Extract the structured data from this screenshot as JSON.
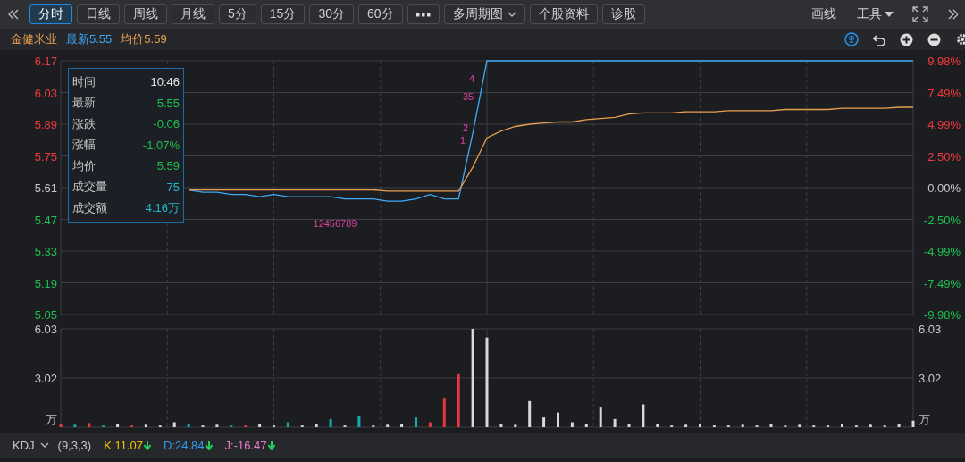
{
  "toolbar": {
    "tabs": [
      {
        "kind": "text",
        "label": "分时",
        "selected": true
      },
      {
        "kind": "text",
        "label": "日线",
        "selected": false
      },
      {
        "kind": "text",
        "label": "周线",
        "selected": false
      },
      {
        "kind": "text",
        "label": "月线",
        "selected": false
      },
      {
        "kind": "text",
        "label": "5分",
        "selected": false
      },
      {
        "kind": "text",
        "label": "15分",
        "selected": false
      },
      {
        "kind": "text",
        "label": "30分",
        "selected": false
      },
      {
        "kind": "text",
        "label": "60分",
        "selected": false
      },
      {
        "kind": "more",
        "selected": false
      },
      {
        "kind": "dropdown",
        "label": "多周期图",
        "selected": false
      },
      {
        "kind": "text",
        "label": "个股资料",
        "selected": false
      },
      {
        "kind": "text",
        "label": "诊股",
        "selected": false
      }
    ],
    "tools": [
      {
        "kind": "plain",
        "label": "画线"
      },
      {
        "kind": "dropdown",
        "label": "工具"
      }
    ]
  },
  "quote": {
    "name": "金健米业",
    "latest": "最新5.55",
    "average": "均价5.59"
  },
  "price_panel": {
    "chart_data": {
      "type": "line",
      "grid": true,
      "ylim": [
        5.05,
        6.17
      ],
      "yticks": [
        6.17,
        6.03,
        5.89,
        5.75,
        5.61,
        5.47,
        5.33,
        5.19,
        5.05
      ],
      "series": [
        {
          "color": "#3fa9f5",
          "values": [
            5.6,
            5.59,
            5.59,
            5.58,
            5.58,
            5.57,
            5.58,
            5.57,
            5.57,
            5.57,
            5.57,
            5.56,
            5.56,
            5.56,
            5.55,
            5.55,
            5.56,
            5.58,
            5.56,
            5.56,
            5.85,
            6.17,
            6.17,
            6.17,
            6.17,
            6.17,
            6.17,
            6.17,
            6.17,
            6.17,
            6.17,
            6.17,
            6.17,
            6.17,
            6.17,
            6.17,
            6.17,
            6.17,
            6.17,
            6.17,
            6.17,
            6.17,
            6.17,
            6.17,
            6.17,
            6.17,
            6.17,
            6.17,
            6.17,
            6.17,
            6.17,
            6.17
          ]
        },
        {
          "color": "#e8a050",
          "values": [
            5.6,
            5.6,
            5.6,
            5.6,
            5.6,
            5.6,
            5.6,
            5.6,
            5.6,
            5.6,
            5.6,
            5.6,
            5.6,
            5.6,
            5.595,
            5.595,
            5.595,
            5.595,
            5.595,
            5.595,
            5.7,
            5.83,
            5.86,
            5.88,
            5.89,
            5.895,
            5.9,
            5.9,
            5.91,
            5.915,
            5.92,
            5.935,
            5.94,
            5.94,
            5.94,
            5.945,
            5.945,
            5.945,
            5.95,
            5.95,
            5.95,
            5.95,
            5.955,
            5.955,
            5.955,
            5.955,
            5.96,
            5.96,
            5.96,
            5.96,
            5.965,
            5.965
          ]
        }
      ],
      "annotations": [
        "12456789",
        "1",
        "2",
        "35",
        "4"
      ]
    },
    "pct_ticks": [
      {
        "label": "9.98%",
        "kind": "up"
      },
      {
        "label": "7.49%",
        "kind": "up"
      },
      {
        "label": "4.99%",
        "kind": "up"
      },
      {
        "label": "2.50%",
        "kind": "up"
      },
      {
        "label": "0.00%",
        "kind": "flat"
      },
      {
        "label": "-2.50%",
        "kind": "down"
      },
      {
        "label": "-4.99%",
        "kind": "down"
      },
      {
        "label": "-7.49%",
        "kind": "down"
      },
      {
        "label": "-9.98%",
        "kind": "down"
      }
    ],
    "tooltip": [
      {
        "label": "时间",
        "value": "10:46",
        "color": "#e6e6e6"
      },
      {
        "label": "最新",
        "value": "5.55",
        "color": "#1fbf4f"
      },
      {
        "label": "涨跌",
        "value": "-0.06",
        "color": "#1fbf4f"
      },
      {
        "label": "涨幅",
        "value": "-1.07%",
        "color": "#1fbf4f"
      },
      {
        "label": "均价",
        "value": "5.59",
        "color": "#1fbf4f"
      },
      {
        "label": "成交量",
        "value": "75",
        "color": "#22b8c8"
      },
      {
        "label": "成交额",
        "value": "4.16万",
        "color": "#22b8c8"
      }
    ]
  },
  "volume_panel": {
    "chart_data": {
      "type": "bar",
      "stacked": true,
      "grid": true,
      "ylim": [
        0,
        6.03
      ],
      "yticks": [
        3.02,
        6.03
      ],
      "ylabel": "万",
      "series": [
        {
          "color": "#e8383d",
          "values": [
            0.2,
            null,
            0.25,
            null,
            null,
            0.1,
            null,
            null,
            null,
            null,
            null,
            null,
            null,
            0.1,
            null,
            null,
            null,
            null,
            null,
            null,
            null,
            null,
            null,
            null,
            null,
            null,
            0.3,
            1.8,
            3.3,
            null,
            null,
            null,
            null,
            null,
            null,
            null,
            null,
            null,
            null,
            null,
            null,
            null,
            null,
            null,
            null,
            null,
            null,
            null,
            null,
            null,
            null,
            null,
            null,
            null,
            null,
            null,
            null,
            null,
            null,
            null,
            null
          ]
        },
        {
          "color": "#1aa9a9",
          "values": [
            null,
            0.15,
            null,
            0.1,
            null,
            null,
            null,
            null,
            null,
            0.2,
            null,
            null,
            0.1,
            null,
            null,
            null,
            0.3,
            null,
            null,
            0.5,
            null,
            0.7,
            null,
            null,
            null,
            0.6,
            null,
            null,
            null,
            null,
            null,
            null,
            null,
            null,
            null,
            null,
            null,
            null,
            null,
            null,
            null,
            null,
            null,
            null,
            null,
            null,
            null,
            null,
            null,
            null,
            null,
            null,
            null,
            null,
            null,
            null,
            null,
            null,
            null,
            null,
            null
          ]
        },
        {
          "color": "#d8d8d8",
          "values": [
            null,
            null,
            null,
            null,
            0.2,
            null,
            0.15,
            0.1,
            0.3,
            null,
            0.1,
            0.15,
            null,
            null,
            0.2,
            0.1,
            null,
            0.1,
            0.2,
            null,
            0.1,
            null,
            0.1,
            0.15,
            0.2,
            null,
            null,
            null,
            null,
            6.03,
            5.5,
            0.2,
            0.15,
            1.6,
            0.6,
            0.9,
            0.3,
            0.2,
            1.2,
            0.5,
            0.2,
            1.4,
            0.2,
            0.1,
            0.15,
            0.2,
            0.1,
            0.1,
            0.15,
            0.1,
            0.2,
            0.1,
            0.15,
            0.1,
            0.1,
            0.2,
            0.1,
            0.15,
            0.1,
            0.2,
            0.4
          ]
        }
      ]
    },
    "right_ticks": [
      "6.03",
      "3.02"
    ],
    "right_unit": "万"
  },
  "indicator_bar": {
    "name": "KDJ",
    "params": "(9,3,3)",
    "values": [
      {
        "text": "K:11.07",
        "color": "#f2c200",
        "falling": true
      },
      {
        "text": "D:24.84",
        "color": "#2f9bf0",
        "falling": true
      },
      {
        "text": "J:-16.47",
        "color": "#e77fc4",
        "falling": true
      }
    ]
  }
}
